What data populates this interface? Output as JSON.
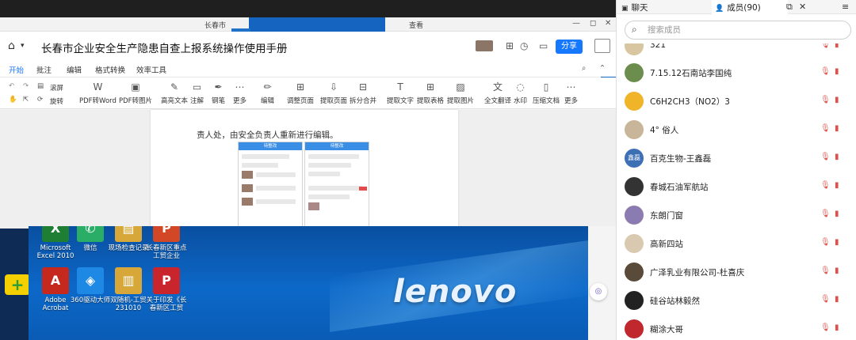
{
  "doc": {
    "window_title": "长春市",
    "window_title_right": "查看",
    "title": "长春市企业安全生产隐患自查上报系统操作使用手册",
    "share_label": "分享",
    "tabs": [
      "开始",
      "批注",
      "编辑",
      "格式转换",
      "效率工具"
    ],
    "small_tools": {
      "select_all": "滚屏",
      "rotate": "旋转"
    },
    "tools": [
      {
        "label": "PDF转Word",
        "icon": "W"
      },
      {
        "label": "PDF转图片",
        "icon": "▣"
      },
      {
        "label": "高亮文本",
        "icon": "✎"
      },
      {
        "label": "注解",
        "icon": "▭"
      },
      {
        "label": "钢笔",
        "icon": "✒"
      },
      {
        "label": "更多",
        "icon": "⋯"
      },
      {
        "label": "编辑",
        "icon": "✏"
      },
      {
        "label": "调整页面",
        "icon": "⊞"
      },
      {
        "label": "提取页面",
        "icon": "⇩"
      },
      {
        "label": "拆分合并",
        "icon": "⊟"
      },
      {
        "label": "提取文字",
        "icon": "T"
      },
      {
        "label": "提取表格",
        "icon": "⊞"
      },
      {
        "label": "提取图片",
        "icon": "▨"
      },
      {
        "label": "全文翻译",
        "icon": "文"
      },
      {
        "label": "水印",
        "icon": "◌"
      },
      {
        "label": "压缩文档",
        "icon": "▯"
      },
      {
        "label": "更多",
        "icon": "⋯"
      }
    ],
    "page_text": "责人处，由安全负责人重新进行编辑。",
    "phone_left_header": "待整改",
    "phone_right_header": "待整改"
  },
  "desktop": {
    "brand": "lenovo",
    "icons": [
      {
        "name": "Microsoft Excel 2010",
        "glyph": "X",
        "color": "#1e7e34"
      },
      {
        "name": "微信",
        "glyph": "✆",
        "color": "#2aae67"
      },
      {
        "name": "现场检查记录",
        "glyph": "▤",
        "color": "#d7a73a"
      },
      {
        "name": "长春新区重点工贸企业",
        "glyph": "P",
        "color": "#d24726"
      },
      {
        "name": "Adobe Acrobat",
        "glyph": "A",
        "color": "#c5281c"
      },
      {
        "name": "360驱动大师",
        "glyph": "◈",
        "color": "#1e88e5"
      },
      {
        "name": "双随机-工贸231010",
        "glyph": "▥",
        "color": "#d7a73a"
      },
      {
        "name": "关于印发《长春新区工贸",
        "glyph": "P",
        "color": "#c8252c"
      }
    ]
  },
  "panel": {
    "tab_chat": "聊天",
    "tab_members": "成员(90)",
    "search_placeholder": "搜索成员",
    "members": [
      {
        "name": "321",
        "avatar": "#d8c6a0",
        "initial": ""
      },
      {
        "name": "7.15.12石南站李国纯",
        "avatar": "#6b8e4e",
        "initial": ""
      },
      {
        "name": "C6H2CH3（NO2）3",
        "avatar": "#f0b429",
        "initial": ""
      },
      {
        "name": "4° 俗人",
        "avatar": "#c9b59a",
        "initial": ""
      },
      {
        "name": "百克生物-王鑫磊",
        "avatar": "#3d6fb5",
        "initial": "鑫磊"
      },
      {
        "name": "春城石油军航站",
        "avatar": "#333333",
        "initial": ""
      },
      {
        "name": "东朗门窗",
        "avatar": "#8a7bb0",
        "initial": ""
      },
      {
        "name": "高新四站",
        "avatar": "#d9c9b0",
        "initial": ""
      },
      {
        "name": "广泽乳业有限公司-杜喜庆",
        "avatar": "#5a4a3a",
        "initial": ""
      },
      {
        "name": "硅谷站林毅然",
        "avatar": "#222222",
        "initial": ""
      },
      {
        "name": "糊涂大哥",
        "avatar": "#c0282d",
        "initial": ""
      }
    ]
  },
  "colors": {
    "accent": "#1677ff",
    "muted_icon": "#d9534f"
  }
}
